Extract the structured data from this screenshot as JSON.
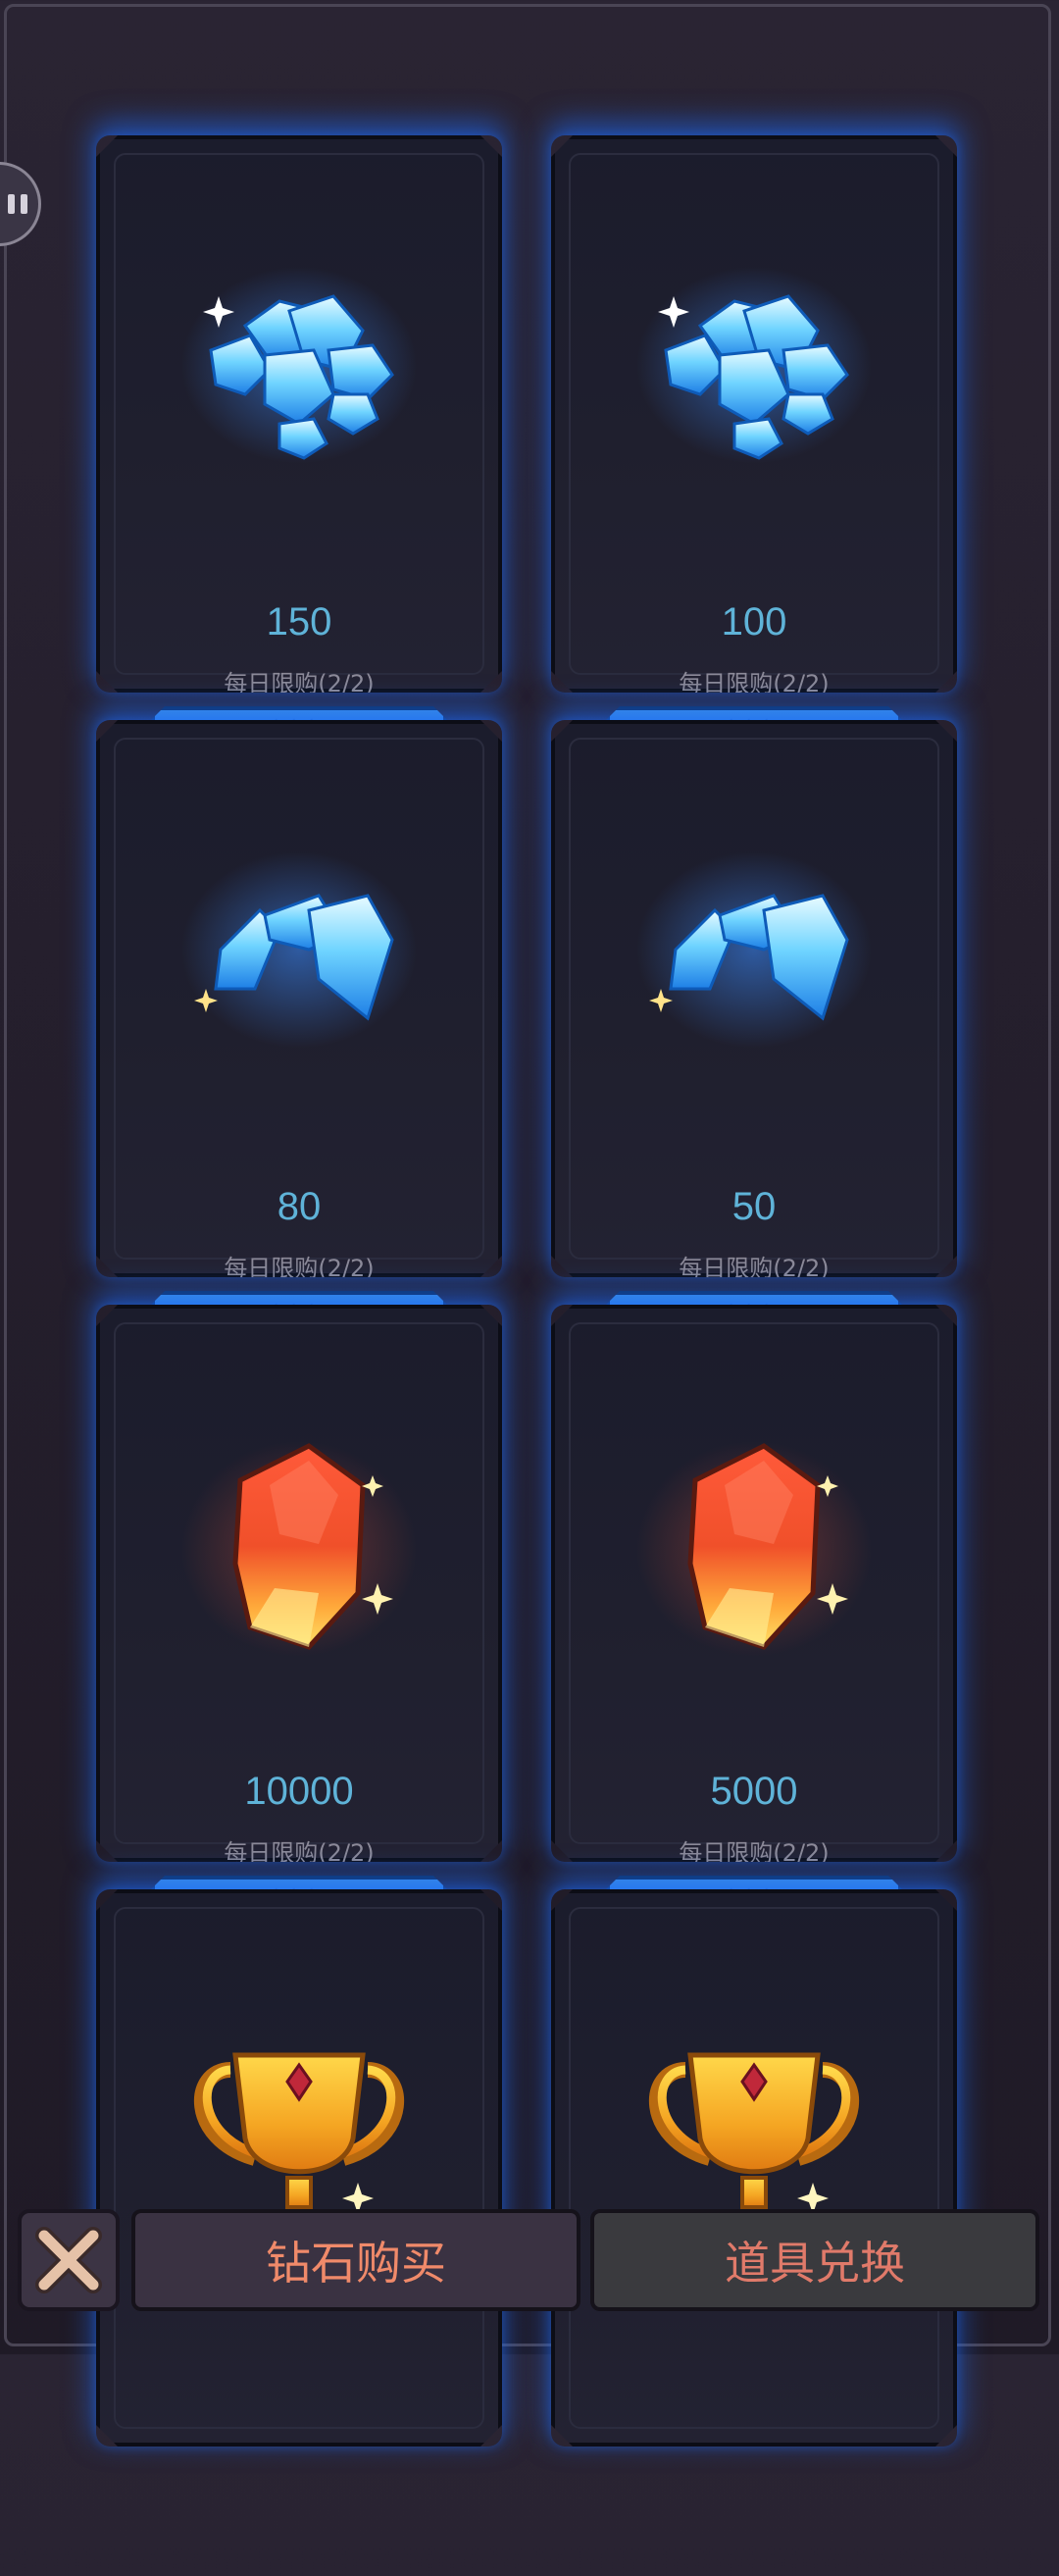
{
  "cards": [
    {
      "amount": "150",
      "limit": "每日限购(2/2)",
      "icon": "diamond-pile-large-icon"
    },
    {
      "amount": "100",
      "limit": "每日限购(2/2)",
      "icon": "diamond-pile-icon"
    },
    {
      "amount": "80",
      "limit": "每日限购(2/2)",
      "icon": "diamond-cluster-icon"
    },
    {
      "amount": "50",
      "limit": "每日限购(2/2)",
      "icon": "diamond-cluster-icon"
    },
    {
      "amount": "10000",
      "limit": "每日限购(2/2)",
      "icon": "red-gem-icon"
    },
    {
      "amount": "5000",
      "limit": "每日限购(2/2)",
      "icon": "red-gem-icon"
    },
    {
      "amount": "",
      "limit": "",
      "icon": "trophy-icon"
    },
    {
      "amount": "",
      "limit": "",
      "icon": "trophy-icon"
    }
  ],
  "watch_ad_icon": "video-play-icon",
  "bottom": {
    "close_icon": "close-icon",
    "tab_diamond": "钻石购买",
    "tab_items": "道具兑换"
  },
  "colors": {
    "amount_text": "#5fb3d8",
    "button_blue": "#2a72c8",
    "tab_text": "#f08a6a"
  }
}
